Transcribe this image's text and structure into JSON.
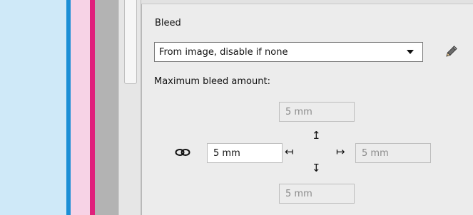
{
  "bleed_section": {
    "title": "Bleed",
    "mode_select": {
      "value": "From image, disable if none"
    },
    "max_bleed_label": "Maximum bleed amount:",
    "fields": {
      "top": "5 mm",
      "left": "5 mm",
      "right": "5 mm",
      "bottom": "5 mm"
    }
  },
  "icons": {
    "edit": "pencil-icon",
    "link": "link-icon",
    "arrow_up": "arrow-up-icon",
    "arrow_down": "arrow-down-icon",
    "arrow_left": "arrow-left-icon",
    "arrow_right": "arrow-right-icon"
  },
  "colors": {
    "preview_background": "#cfe9f8",
    "bleed_blue": "#1b8fd6",
    "bleed_pink_light": "#f7d3e6",
    "bleed_magenta": "#e0207c",
    "panel_background": "#ececec"
  }
}
